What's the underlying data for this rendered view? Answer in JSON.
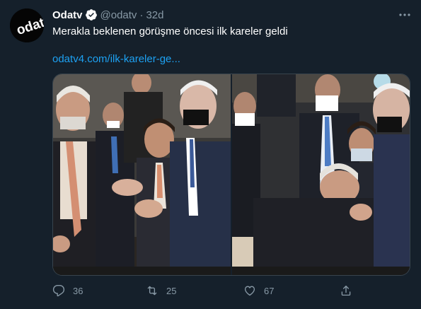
{
  "tweet": {
    "author_name": "Odatv",
    "handle": "@odatv",
    "separator": "·",
    "time": "32d",
    "text": "Merakla beklenen görüşme öncesi ilk kareler geldi",
    "link": "odatv4.com/ilk-kareler-ge...",
    "avatar_logo": "odatv",
    "verified_icon": "verified-badge-icon",
    "more_icon": "more-horizontal-icon"
  },
  "actions": {
    "reply_count": "36",
    "retweet_count": "25",
    "like_count": "67",
    "reply_icon": "reply-icon",
    "retweet_icon": "retweet-icon",
    "like_icon": "heart-icon",
    "share_icon": "share-icon"
  },
  "colors": {
    "background": "#15202b",
    "text": "#ffffff",
    "secondary": "#8899a6",
    "link": "#1da1f2",
    "border": "#38444d"
  }
}
